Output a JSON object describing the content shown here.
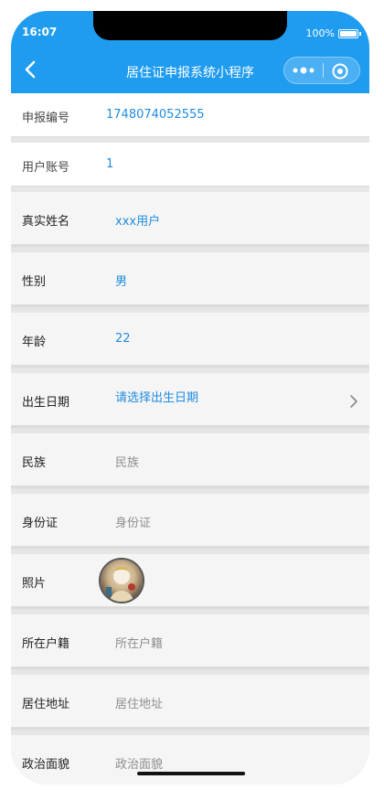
{
  "status": {
    "time": "16:07",
    "battery": "100%"
  },
  "nav": {
    "title": "居住证申报系统小程序"
  },
  "colors": {
    "primary": "#1f9cf0",
    "value_blue": "#1f8ce0",
    "placeholder_gray": "#8e8e8e"
  },
  "fields": [
    {
      "label": "申报编号",
      "value": "1748074052555"
    },
    {
      "label": "用户账号",
      "value": "1"
    },
    {
      "label": "真实姓名",
      "value": "xxx用户"
    },
    {
      "label": "性别",
      "value": "男"
    },
    {
      "label": "年龄",
      "value": "22"
    },
    {
      "label": "出生日期",
      "value": "请选择出生日期"
    },
    {
      "label": "民族",
      "placeholder": "民族"
    },
    {
      "label": "身份证",
      "placeholder": "身份证"
    },
    {
      "label": "照片"
    },
    {
      "label": "所在户籍",
      "placeholder": "所在户籍"
    },
    {
      "label": "居住地址",
      "placeholder": "居住地址"
    },
    {
      "label": "政治面貌",
      "placeholder": "政治面貌"
    }
  ],
  "icons": {
    "back": "chevron-left-icon",
    "more": "more-dots-icon",
    "close": "target-close-icon",
    "date_chevron": "chevron-right-icon",
    "battery": "battery-icon"
  }
}
